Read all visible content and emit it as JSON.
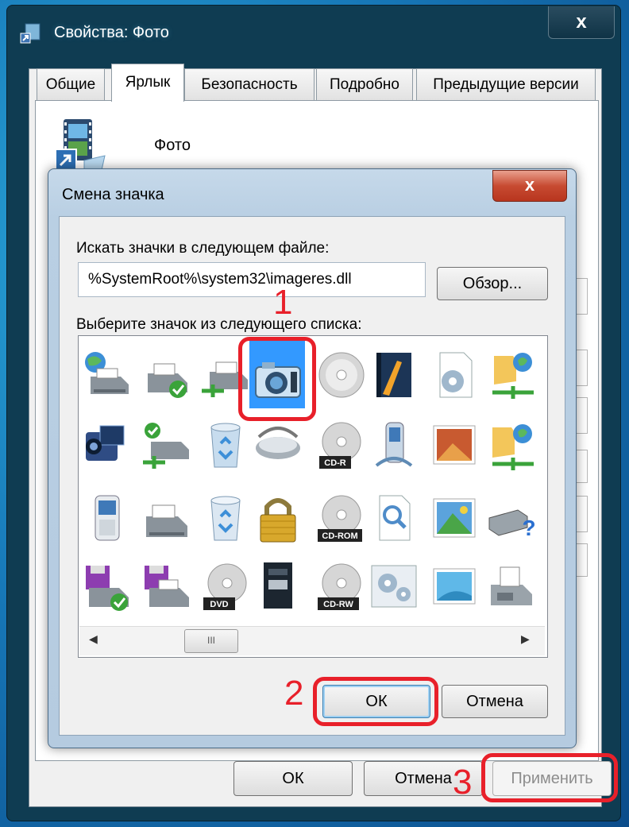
{
  "window": {
    "title": "Свойства: Фото",
    "close_glyph": "x",
    "tabs": [
      {
        "label": "Общие",
        "active": false
      },
      {
        "label": "Ярлык",
        "active": true
      },
      {
        "label": "Безопасность",
        "active": false
      },
      {
        "label": "Подробно",
        "active": false
      },
      {
        "label": "Предыдущие версии",
        "active": false
      }
    ],
    "shortcut_name": "Фото",
    "buttons": {
      "ok": "ОК",
      "cancel": "Отмена",
      "apply": "Применить"
    }
  },
  "dialog": {
    "title": "Смена значка",
    "close_glyph": "x",
    "file_label": "Искать значки в следующем файле:",
    "file_path": "%SystemRoot%\\system32\\imageres.dll",
    "browse_label": "Обзор...",
    "list_label": "Выберите значок из следующего списка:",
    "icons": [
      [
        "network-printer-icon",
        "printer-share-icon",
        "printer-network-icon",
        "camera-icon",
        "cd-disc-icon",
        "book-icon",
        "settings-file-icon",
        "network-folder-icon"
      ],
      [
        "camcorder-icon",
        "printer-check-icon",
        "recycle-bin-full-icon",
        "scanner-icon",
        "cd-r-icon",
        "mobile-device-icon",
        "picture-icon",
        "network-folder-2-icon"
      ],
      [
        "mobile-phone-icon",
        "printer-icon",
        "recycle-bin-empty-icon",
        "padlock-icon",
        "cd-rom-icon",
        "search-document-icon",
        "image-landscape-icon",
        "drive-help-icon"
      ],
      [
        "floppy-check-icon",
        "floppy-printer-icon",
        "dvd-icon",
        "memory-card-icon",
        "cd-rw-icon",
        "gears-window-icon",
        "desktop-image-icon",
        "fax-icon"
      ]
    ],
    "disc_labels": {
      "cdr": "CD-R",
      "cdrom": "CD-ROM",
      "dvd": "DVD",
      "cdrw": "CD-RW"
    },
    "selected_icon": "camera-icon",
    "scroll_thumb": "III",
    "buttons": {
      "ok": "ОК",
      "cancel": "Отмена"
    }
  },
  "annotations": [
    "1",
    "2",
    "3"
  ],
  "colors": {
    "annotation": "#e8202a",
    "selection": "#3399ff"
  }
}
